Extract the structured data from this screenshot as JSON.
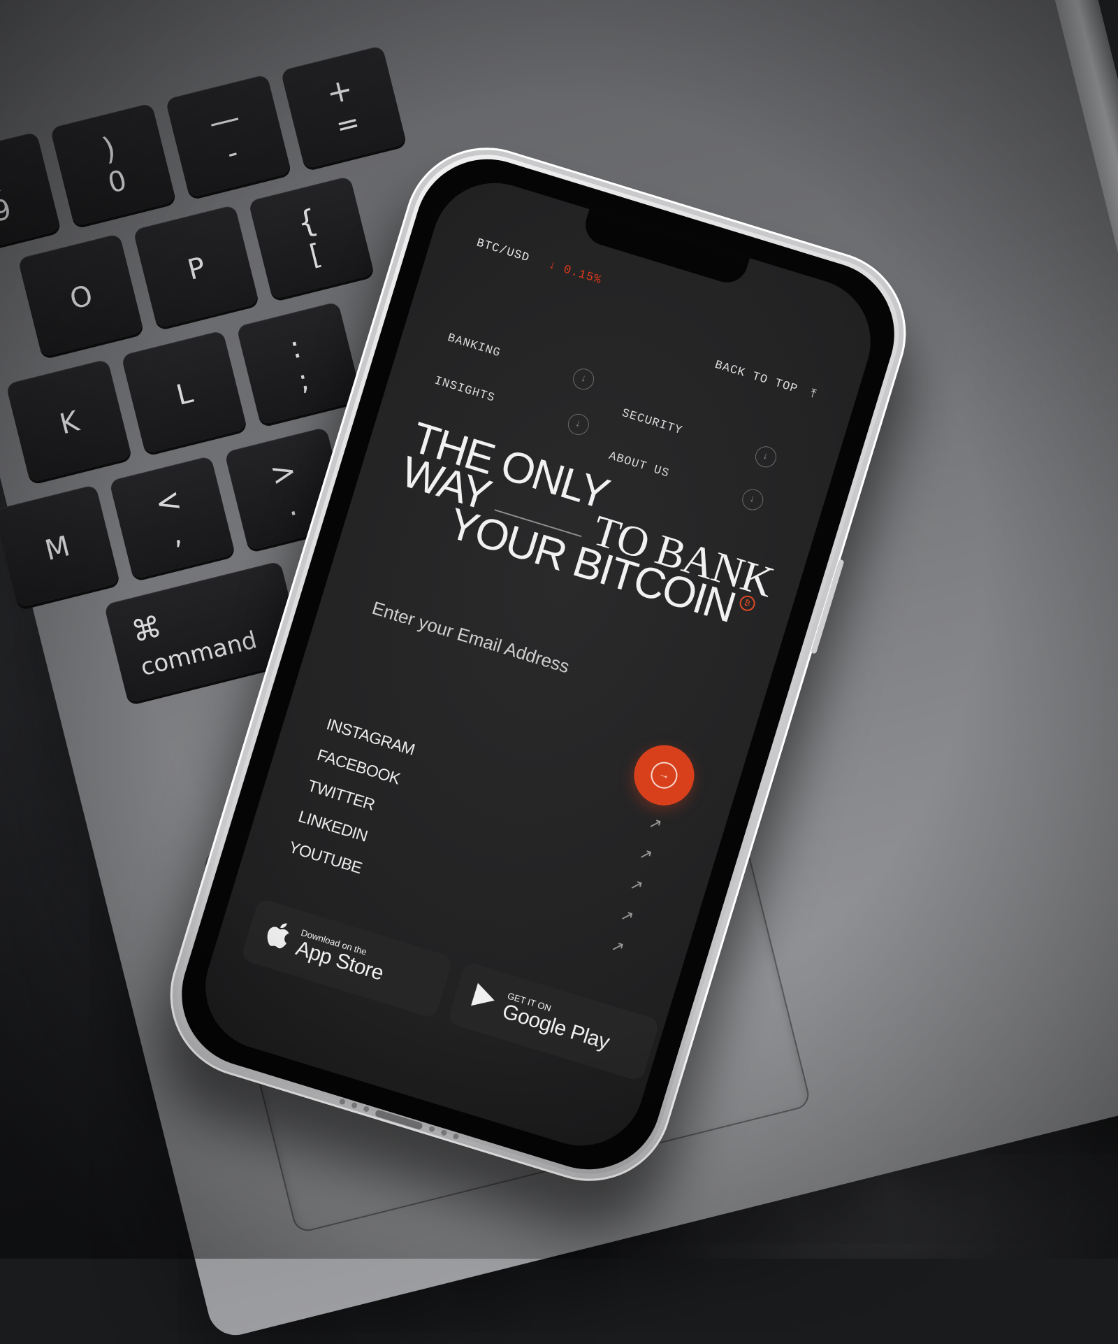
{
  "keyboard": {
    "keys": [
      {
        "top": "(",
        "bottom": "9"
      },
      {
        "top": ")",
        "bottom": "0"
      },
      {
        "top": "—",
        "bottom": "-"
      },
      {
        "top": "+",
        "bottom": "="
      },
      {
        "top": "",
        "bottom": "O"
      },
      {
        "top": "",
        "bottom": "P"
      },
      {
        "top": "{",
        "bottom": "["
      },
      {
        "top": "",
        "bottom": "K"
      },
      {
        "top": "",
        "bottom": "L"
      },
      {
        "top": ":",
        "bottom": ";"
      },
      {
        "top": "",
        "bottom": "M"
      },
      {
        "top": "<",
        "bottom": ","
      },
      {
        "top": ">",
        "bottom": "."
      },
      {
        "top": "⌘",
        "bottom": "command"
      }
    ]
  },
  "phone": {
    "ticker": {
      "pair": "BTC/USD",
      "change": "↓ 0.15%",
      "change_color": "#e33a1a"
    },
    "back_to_top": {
      "label": "BACK TO TOP",
      "icon": "arrow-up-to-line-icon"
    },
    "menu": [
      {
        "label": "BANKING",
        "icon": "arrow-down-circle-icon"
      },
      {
        "label": "SECURITY",
        "icon": "arrow-down-circle-icon"
      },
      {
        "label": "INSIGHTS",
        "icon": "arrow-down-circle-icon"
      },
      {
        "label": "ABOUT US",
        "icon": "arrow-down-circle-icon"
      }
    ],
    "hero": {
      "line1": "THE ONLY",
      "line2a": "WAY",
      "line2b": "TO BANK",
      "line3": "YOUR BITCOIN",
      "mark": "₿"
    },
    "email": {
      "placeholder": "Enter your Email Address",
      "submit_icon": "arrow-right-circle-icon",
      "accent": "#d8401c"
    },
    "socials": [
      {
        "label": "INSTAGRAM",
        "icon": "arrow-up-right-icon"
      },
      {
        "label": "FACEBOOK",
        "icon": "arrow-up-right-icon"
      },
      {
        "label": "TWITTER",
        "icon": "arrow-up-right-icon"
      },
      {
        "label": "LINKEDIN",
        "icon": "arrow-up-right-icon"
      },
      {
        "label": "YOUTUBE",
        "icon": "arrow-up-right-icon"
      }
    ],
    "stores": {
      "apple": {
        "small": "Download on the",
        "big": "App Store",
        "icon": "apple-icon"
      },
      "google": {
        "small": "GET IT ON",
        "big": "Google Play",
        "icon": "play-icon"
      }
    }
  }
}
